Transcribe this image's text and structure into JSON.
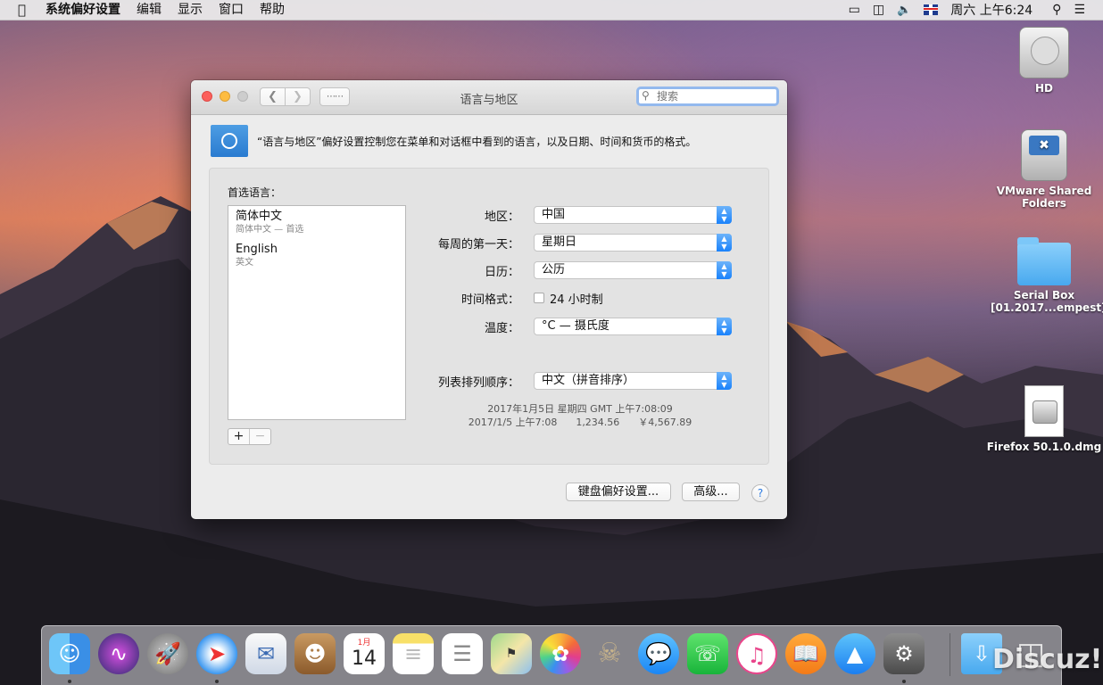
{
  "menubar": {
    "app_name": "系统偏好设置",
    "items": [
      "编辑",
      "显示",
      "窗口",
      "帮助"
    ],
    "clock": "周六 上午6:24"
  },
  "desktop": {
    "icons": [
      {
        "label": "HD"
      },
      {
        "label": "VMware Shared Folders"
      },
      {
        "label": "Serial Box [01.2017...empest]"
      },
      {
        "label": "Firefox 50.1.0.dmg"
      }
    ]
  },
  "window": {
    "title": "语言与地区",
    "search_placeholder": "搜索",
    "description": "“语言与地区”偏好设置控制您在菜单和对话框中看到的语言，以及日期、时间和货币的格式。",
    "preferred_languages_label": "首选语言：",
    "languages": [
      {
        "name": "简体中文",
        "sub": "简体中文 — 首选"
      },
      {
        "name": "English",
        "sub": "英文"
      }
    ],
    "add_label": "+",
    "remove_label": "−",
    "settings": {
      "region_label": "地区：",
      "region_value": "中国",
      "first_day_label": "每周的第一天：",
      "first_day_value": "星期日",
      "calendar_label": "日历：",
      "calendar_value": "公历",
      "time_format_label": "时间格式：",
      "time_format_checkbox": "24 小时制",
      "temperature_label": "温度：",
      "temperature_value": "°C — 摄氏度",
      "sort_order_label": "列表排列顺序：",
      "sort_order_value": "中文（拼音排序）"
    },
    "sample_line1": "2017年1月5日 星期四 GMT 上午7:08:09",
    "sample_line2": "2017/1/5 上午7:08      1,234.56      ￥4,567.89",
    "keyboard_button": "键盘偏好设置...",
    "advanced_button": "高级...",
    "help_label": "?"
  },
  "dock": {
    "calendar_month": "1月",
    "calendar_day": "14"
  },
  "watermark": "Discuz!"
}
